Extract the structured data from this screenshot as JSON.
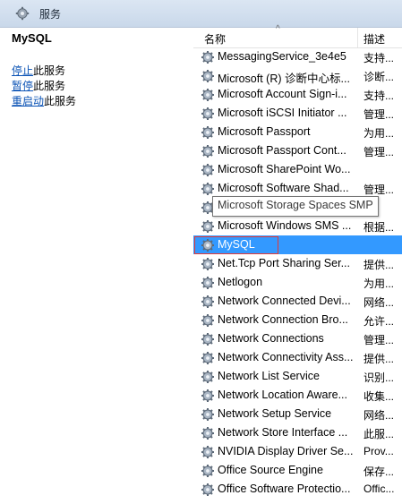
{
  "window": {
    "title": "服务"
  },
  "left": {
    "service_name": "MySQL",
    "actions": [
      {
        "link": "停止",
        "rest": "此服务"
      },
      {
        "link": "暂停",
        "rest": "此服务"
      },
      {
        "link": "重启动",
        "rest": "此服务"
      }
    ]
  },
  "columns": {
    "name": "名称",
    "desc": "描述",
    "sort_indicator": "^"
  },
  "tooltip": "Microsoft Storage Spaces SMP",
  "services": [
    {
      "name": "MessagingService_3e4e5",
      "desc": "支持..."
    },
    {
      "name": "Microsoft (R) 诊断中心标...",
      "desc": "诊断..."
    },
    {
      "name": "Microsoft Account Sign-i...",
      "desc": "支持..."
    },
    {
      "name": "Microsoft iSCSI Initiator ...",
      "desc": "管理..."
    },
    {
      "name": "Microsoft Passport",
      "desc": "为用..."
    },
    {
      "name": "Microsoft Passport Cont...",
      "desc": "管理..."
    },
    {
      "name": "Microsoft SharePoint Wo...",
      "desc": ""
    },
    {
      "name": "Microsoft Software Shad...",
      "desc": "管理..."
    },
    {
      "name": "Microsoft Storage Spaces SMP",
      "desc": ""
    },
    {
      "name": "Microsoft Windows SMS ...",
      "desc": "根据..."
    },
    {
      "name": "MySQL",
      "desc": "",
      "selected": true
    },
    {
      "name": "Net.Tcp Port Sharing Ser...",
      "desc": "提供..."
    },
    {
      "name": "Netlogon",
      "desc": "为用..."
    },
    {
      "name": "Network Connected Devi...",
      "desc": "网络..."
    },
    {
      "name": "Network Connection Bro...",
      "desc": "允许..."
    },
    {
      "name": "Network Connections",
      "desc": "管理..."
    },
    {
      "name": "Network Connectivity Ass...",
      "desc": "提供..."
    },
    {
      "name": "Network List Service",
      "desc": "识别..."
    },
    {
      "name": "Network Location Aware...",
      "desc": "收集..."
    },
    {
      "name": "Network Setup Service",
      "desc": "网络..."
    },
    {
      "name": "Network Store Interface ...",
      "desc": "此服..."
    },
    {
      "name": "NVIDIA Display Driver Se...",
      "desc": "Prov..."
    },
    {
      "name": "Office  Source Engine",
      "desc": "保存..."
    },
    {
      "name": "Office Software Protectio...",
      "desc": "Offic..."
    }
  ]
}
